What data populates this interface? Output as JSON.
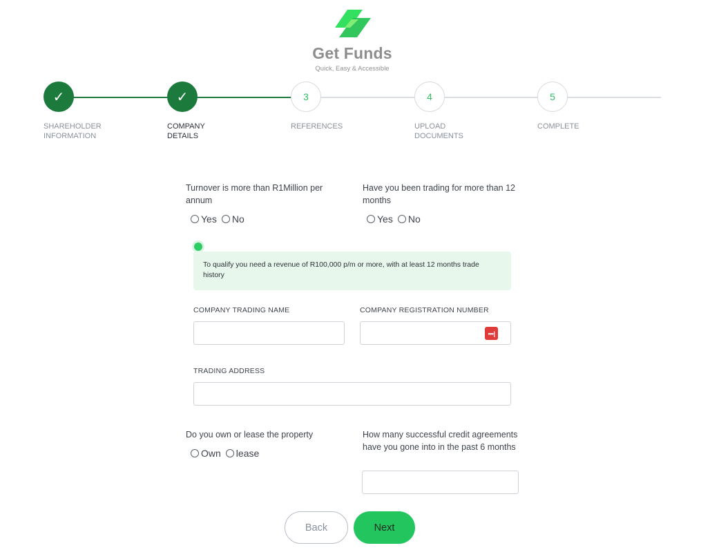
{
  "brand": {
    "name": "Get Funds",
    "tagline": "Quick, Easy & Accessible",
    "colors": {
      "primary_green": "#22c55e",
      "dark_green": "#1c7a3d",
      "logo_green": "#2ee05a"
    }
  },
  "stepper": {
    "steps": [
      {
        "marker": "✓",
        "label": "Shareholder\nInformation",
        "status": "done"
      },
      {
        "marker": "✓",
        "label": "Company\nDetails",
        "status": "active"
      },
      {
        "marker": "3",
        "label": "References",
        "status": "todo"
      },
      {
        "marker": "4",
        "label": "Upload\nDocuments",
        "status": "todo"
      },
      {
        "marker": "5",
        "label": "Complete",
        "status": "todo"
      }
    ]
  },
  "form": {
    "turnover": {
      "question": "Turnover is more than R1Million per annum",
      "options": [
        "Yes",
        "No"
      ]
    },
    "trading": {
      "question": "Have you been trading for more than 12 months",
      "options": [
        "Yes",
        "No"
      ]
    },
    "notice": "To qualify you need a revenue of R100,000 p/m or more, with at least 12 months trade history",
    "trading_name": {
      "label": "COMPANY TRADING NAME",
      "value": ""
    },
    "registration_number": {
      "label": "COMPANY REGISTRATION NUMBER",
      "value": "",
      "icon": "password-manager-icon"
    },
    "trading_address": {
      "label": "TRADING ADDRESS",
      "value": ""
    },
    "property": {
      "question": "Do you own or lease the property",
      "options": [
        "Own",
        "lease"
      ]
    },
    "credit_agreements": {
      "question": "How many successful credit agreements have you gone into in the past 6 months",
      "value": ""
    }
  },
  "buttons": {
    "back": "Back",
    "next": "Next"
  }
}
